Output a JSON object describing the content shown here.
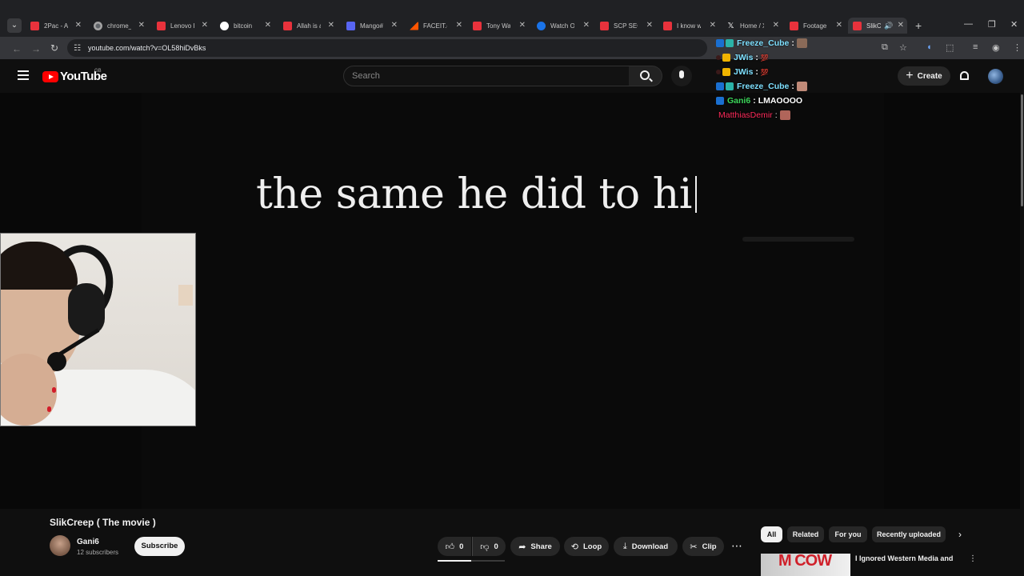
{
  "browser": {
    "tabs": [
      {
        "label": "2Pac - Al",
        "favicon": "youtube"
      },
      {
        "label": "chrome_",
        "favicon": "chrome"
      },
      {
        "label": "Lenovo I",
        "favicon": "youtube"
      },
      {
        "label": "bitcoin",
        "favicon": "google"
      },
      {
        "label": "Allah is a",
        "favicon": "youtube"
      },
      {
        "label": "Mango#",
        "favicon": "discord"
      },
      {
        "label": "FACEIT.c",
        "favicon": "faceit"
      },
      {
        "label": "Tony Wa",
        "favicon": "youtube"
      },
      {
        "label": "Watch O",
        "favicon": "watch"
      },
      {
        "label": "SCP SEC",
        "favicon": "youtube"
      },
      {
        "label": "I know w",
        "favicon": "youtube"
      },
      {
        "label": "Home / X",
        "favicon": "x"
      },
      {
        "label": "Footage",
        "favicon": "youtube"
      },
      {
        "label": "SlikC",
        "favicon": "youtube",
        "active": true
      }
    ],
    "url": "youtube.com/watch?v=OL58hiDvBks"
  },
  "youtube": {
    "logo_text": "YouTube",
    "region": "GB",
    "search_placeholder": "Search",
    "create_label": "Create"
  },
  "video": {
    "overlay_text": "the same he did to hi"
  },
  "chat": [
    {
      "name": "Freeze_Cube",
      "message": "",
      "name_color": "#7ee0ff",
      "emote": true
    },
    {
      "name": "JWis",
      "message": "💯",
      "name_color": "#7ee0ff",
      "emote": false
    },
    {
      "name": "JWis",
      "message": "💯",
      "name_color": "#7ee0ff",
      "emote": false
    },
    {
      "name": "Freeze_Cube",
      "message": "",
      "name_color": "#7ee0ff",
      "emote": true
    },
    {
      "name": "Gani6",
      "message": "LMAOOOO",
      "name_color": "#3cd65a",
      "emote": false
    },
    {
      "name": "MatthiasDemir",
      "message": "",
      "name_color": "#ff2a5a",
      "emote": true
    }
  ],
  "details": {
    "title": "SlikCreep ( The movie )",
    "channel": "Gani6",
    "subscribers": "12 subscribers",
    "subscribe_label": "Subscribe",
    "like_count": "0",
    "dislike_count": "0",
    "share_label": "Share",
    "loop_label": "Loop",
    "download_label": "Download",
    "clip_label": "Clip"
  },
  "sidebar": {
    "chips": [
      "All",
      "Related",
      "For you",
      "Recently uploaded"
    ],
    "selected_chip": "All",
    "recommendation_title": "I Ignored Western Media and",
    "recommendation_thumb_text": "M COW"
  },
  "colors": {
    "background": "#0f0f0f",
    "accent": "#ff0000",
    "chrome_bar": "#202124"
  }
}
